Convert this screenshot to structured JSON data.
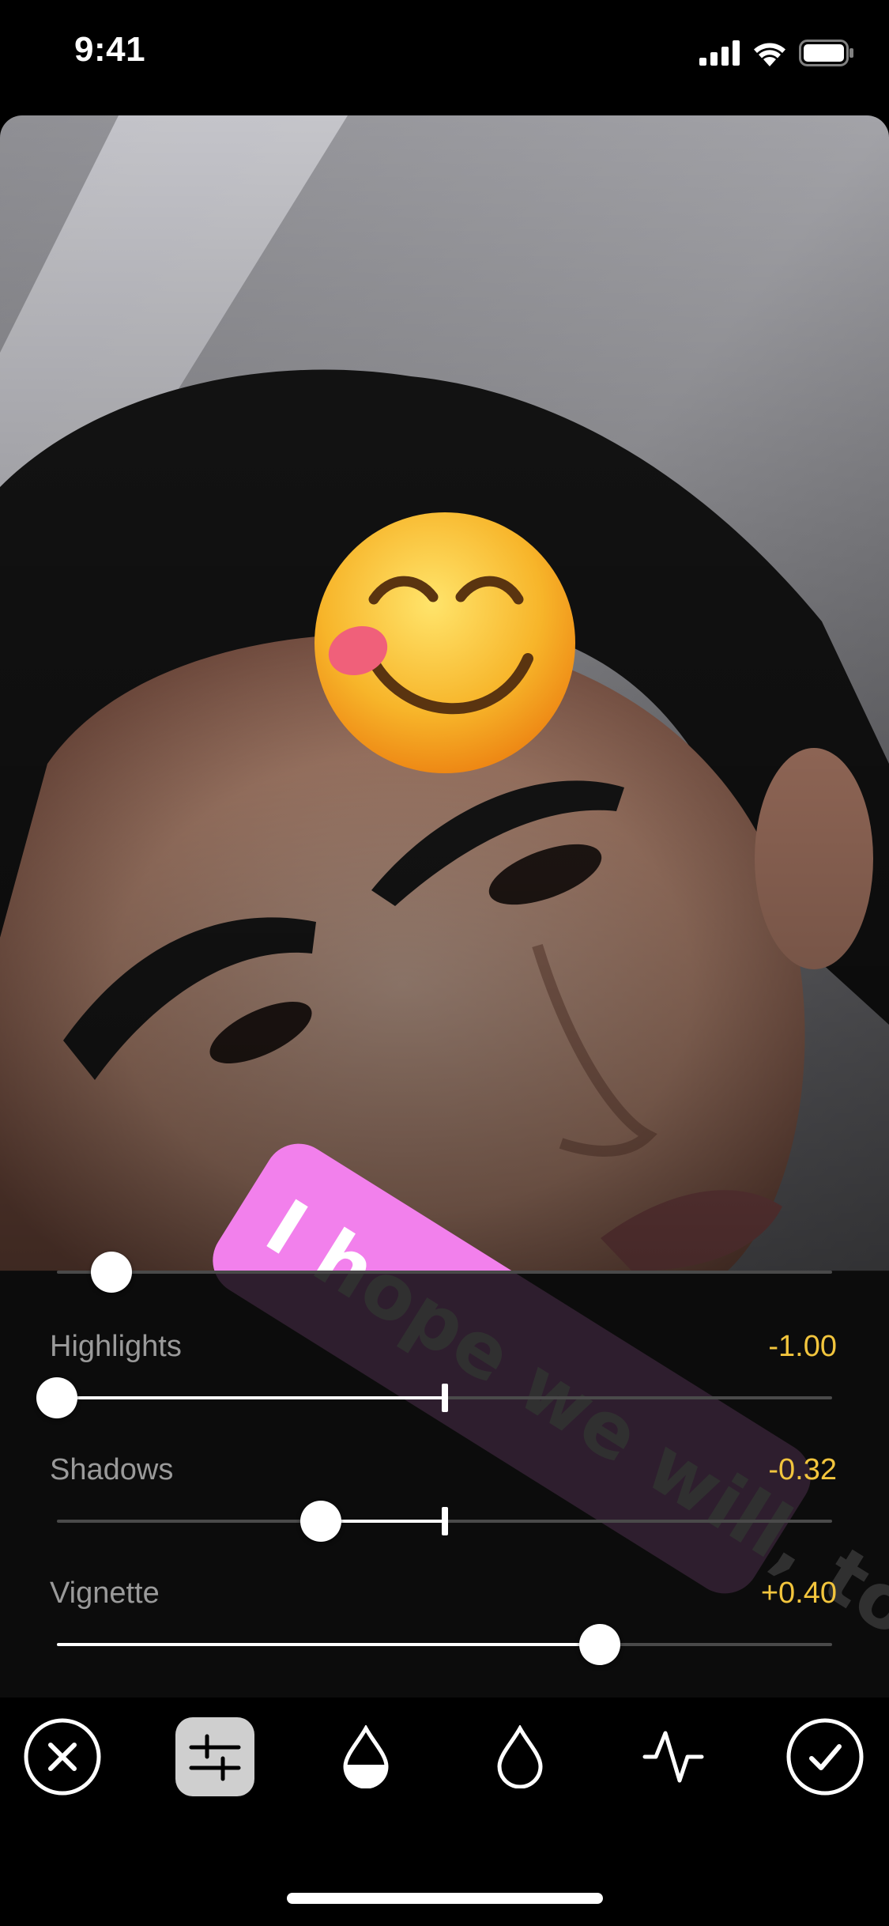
{
  "status_bar": {
    "time": "9:41",
    "icons": [
      "cellular-signal-icon",
      "wifi-icon",
      "battery-icon"
    ]
  },
  "photo": {
    "stickers": {
      "emoji": "😋",
      "text": "I hope we will, too"
    },
    "sticker_color": "#f280ec"
  },
  "adjustments": {
    "top_slider": {
      "value": 0.07
    },
    "rows": [
      {
        "label": "Highlights",
        "value_text": "-1.00",
        "value": -1.0
      },
      {
        "label": "Shadows",
        "value_text": "-0.32",
        "value": -0.32
      },
      {
        "label": "Vignette",
        "value_text": "+0.40",
        "value": 0.4
      }
    ],
    "value_color": "#f2c53d"
  },
  "toolbar": {
    "tools": [
      "cancel-icon",
      "adjust-sliders-icon",
      "tone-drop-icon",
      "color-drop-icon",
      "curve-icon",
      "confirm-icon"
    ],
    "active_tool": "adjust-sliders-icon"
  }
}
